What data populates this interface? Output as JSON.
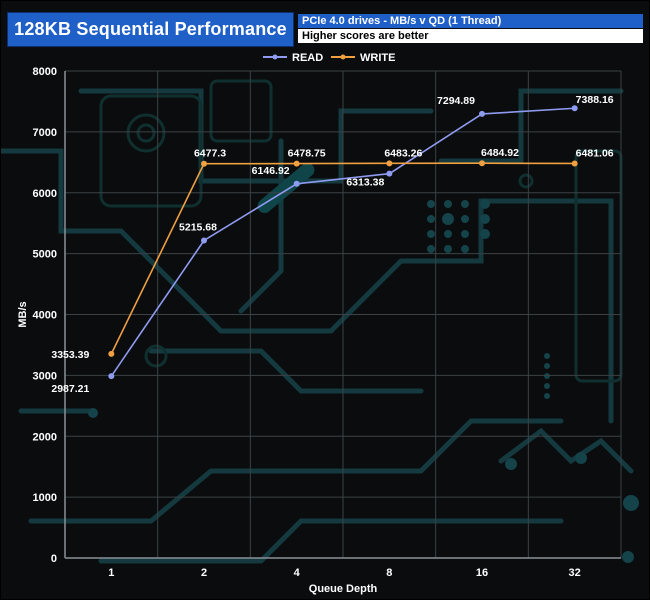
{
  "header": {
    "title": "128KB Sequential Performance",
    "subtitle": "PCIe 4.0 drives - MB/s v QD (1 Thread)",
    "note": "Higher scores are better"
  },
  "colors": {
    "title_bg": "#1f5fc8",
    "read": "#8f9bf0",
    "write": "#f0a040",
    "background": "#0a0c0e",
    "circuit": "#14393f"
  },
  "chart_data": {
    "type": "line",
    "xlabel": "Queue Depth",
    "ylabel": "MB/s",
    "categories": [
      "1",
      "2",
      "4",
      "8",
      "16",
      "32"
    ],
    "ylim": [
      0,
      8000
    ],
    "yticks": [
      "0",
      "1000",
      "2000",
      "3000",
      "4000",
      "5000",
      "6000",
      "7000",
      "8000"
    ],
    "grid": true,
    "legend_position": "top",
    "series": [
      {
        "name": "READ",
        "values": [
          2987.21,
          5215.68,
          6146.92,
          6313.38,
          7294.89,
          7388.16
        ],
        "labels": [
          "2987.21",
          "5215.68",
          "6146.92",
          "6313.38",
          "7294.89",
          "7388.16"
        ]
      },
      {
        "name": "WRITE",
        "values": [
          3353.39,
          6477.3,
          6478.75,
          6483.26,
          6484.92,
          6481.06
        ],
        "labels": [
          "3353.39",
          "6477.3",
          "6478.75",
          "6483.26",
          "6484.92",
          "6481.06"
        ]
      }
    ]
  }
}
